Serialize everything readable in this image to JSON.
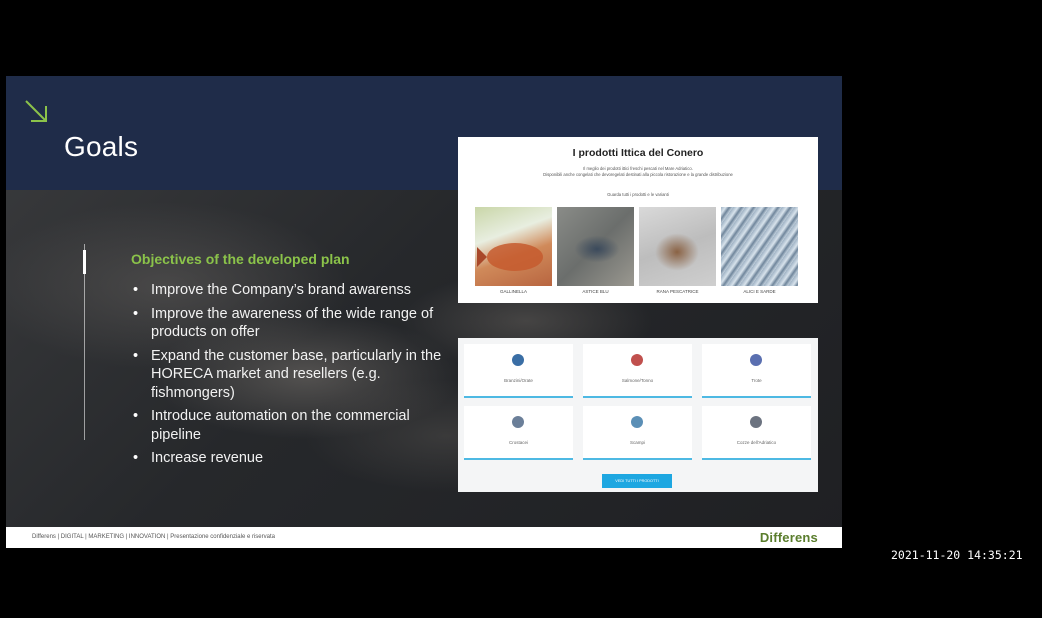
{
  "slide": {
    "title": "Goals",
    "heading": "Objectives of the developed plan",
    "bullets": [
      "Improve the Company’s brand awarenss",
      "Improve the awareness of the wide range of products on offer",
      "Expand the customer base, particularly in the HORECA market and resellers (e.g. fishmongers)",
      "Introduce automation on the commercial pipeline",
      "Increase revenue"
    ],
    "accent_color": "#8bc34a",
    "header_color": "#1f2c49"
  },
  "products_panel": {
    "title": "I prodotti Ittica del Conero",
    "subtitle_line1": "Il meglio dei prodotti ittici freschi pescati nel Mare Adriatico.",
    "subtitle_line2": "Disponibili anche congelati che devoregelati destinati alla piccola ristorazione e la grande distribuzione",
    "link": "Guarda tutti i prodotti e le varianti",
    "items": [
      {
        "label": "GALLINELLA"
      },
      {
        "label": "ASTICE BLU"
      },
      {
        "label": "RANA PESCATRICE"
      },
      {
        "label": "ALICI E SARDE"
      }
    ]
  },
  "categories_panel": {
    "items": [
      {
        "label": "Branzini/Orate",
        "icon": "fish-icon",
        "color": "#3a6ea5"
      },
      {
        "label": "Salmone/Tonno",
        "icon": "fish-icon",
        "color": "#c0504d"
      },
      {
        "label": "Trote",
        "icon": "fish-icon",
        "color": "#5a6fb0"
      },
      {
        "label": "Crostacei",
        "icon": "shrimp-icon",
        "color": "#6b7f99"
      },
      {
        "label": "Scampi",
        "icon": "shrimp-icon",
        "color": "#5b8fb6"
      },
      {
        "label": "Cozze dell'Adriatico",
        "icon": "mussel-icon",
        "color": "#6c7380"
      }
    ],
    "button": "VEDI TUTTI I PRODOTTI"
  },
  "footer": {
    "text": "Differens | DIGITAL | MARKETING | INNOVATION | Presentazione confidenziale e riservata",
    "logo": "Differens"
  },
  "timestamp": "2021-11-20 14:35:21"
}
